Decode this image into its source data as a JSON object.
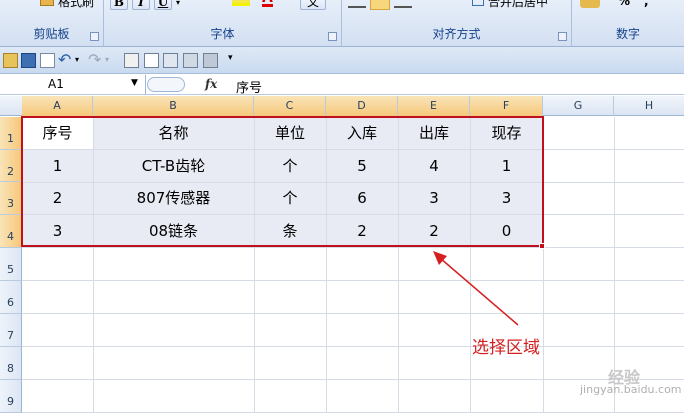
{
  "ribbon": {
    "groups": [
      {
        "name": "clipboard",
        "label": "剪贴板"
      },
      {
        "name": "font",
        "label": "字体"
      },
      {
        "name": "alignment",
        "label": "对齐方式"
      },
      {
        "name": "number",
        "label": "数字"
      }
    ],
    "format_painter_label": "格式刷",
    "merge_center_label": "合并后居中",
    "bold_label": "B",
    "italic_label": "I",
    "underline_label": "U",
    "wen_label": "文",
    "percent_label": "%"
  },
  "formula_bar": {
    "name_box": "A1",
    "fx_label": "fx",
    "formula": "序号"
  },
  "columns": [
    "A",
    "B",
    "C",
    "D",
    "E",
    "F",
    "G",
    "H"
  ],
  "rows": [
    "1",
    "2",
    "3",
    "4",
    "5",
    "6",
    "7",
    "8",
    "9"
  ],
  "table": [
    [
      "序号",
      "名称",
      "单位",
      "入库",
      "出库",
      "现存"
    ],
    [
      "1",
      "CT-B齿轮",
      "个",
      "5",
      "4",
      "1"
    ],
    [
      "2",
      "807传感器",
      "个",
      "6",
      "3",
      "3"
    ],
    [
      "3",
      "08链条",
      "条",
      "2",
      "2",
      "0"
    ]
  ],
  "annotation": "选择区域",
  "watermark": {
    "line1": "经验",
    "line2": "jingyan.baidu.com"
  },
  "colors": {
    "selection_border": "#c0101e",
    "annotation": "#d42020",
    "ribbon_text": "#15428b"
  }
}
